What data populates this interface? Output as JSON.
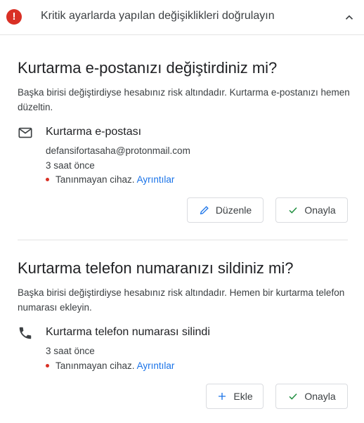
{
  "header": {
    "icon_text": "!",
    "title": "Kritik ayarlarda yapılan değişiklikleri doğrulayın",
    "collapse_icon": "chevron-up-icon",
    "alert_color": "#d93025"
  },
  "sections": [
    {
      "title": "Kurtarma e-postanızı değiştirdiniz mi?",
      "description": "Başka birisi değiştirdiyse hesabınız risk altındadır. Kurtarma e-postanızı hemen düzeltin.",
      "item": {
        "icon": "mail-icon",
        "title": "Kurtarma e-postası",
        "value": "defansifortasaha@protonmail.com",
        "time": "3 saat önce",
        "warning": "Tanınmayan cihaz.",
        "link": "Ayrıntılar"
      },
      "buttons": {
        "secondary_label": "Düzenle",
        "secondary_icon": "pencil-icon",
        "primary_label": "Onayla",
        "primary_icon": "check-icon"
      }
    },
    {
      "title": "Kurtarma telefon numaranızı sildiniz mi?",
      "description": "Başka birisi değiştirdiyse hesabınız risk altındadır. Hemen bir kurtarma telefon numarası ekleyin.",
      "item": {
        "icon": "phone-icon",
        "title": "Kurtarma telefon numarası silindi",
        "time": "3 saat önce",
        "warning": "Tanınmayan cihaz.",
        "link": "Ayrıntılar"
      },
      "buttons": {
        "secondary_label": "Ekle",
        "secondary_icon": "plus-icon",
        "primary_label": "Onayla",
        "primary_icon": "check-icon"
      }
    }
  ],
  "colors": {
    "link": "#1a73e8",
    "warning_dot": "#d93025",
    "check": "#1e8e3e",
    "icon_blue": "#1a73e8"
  }
}
